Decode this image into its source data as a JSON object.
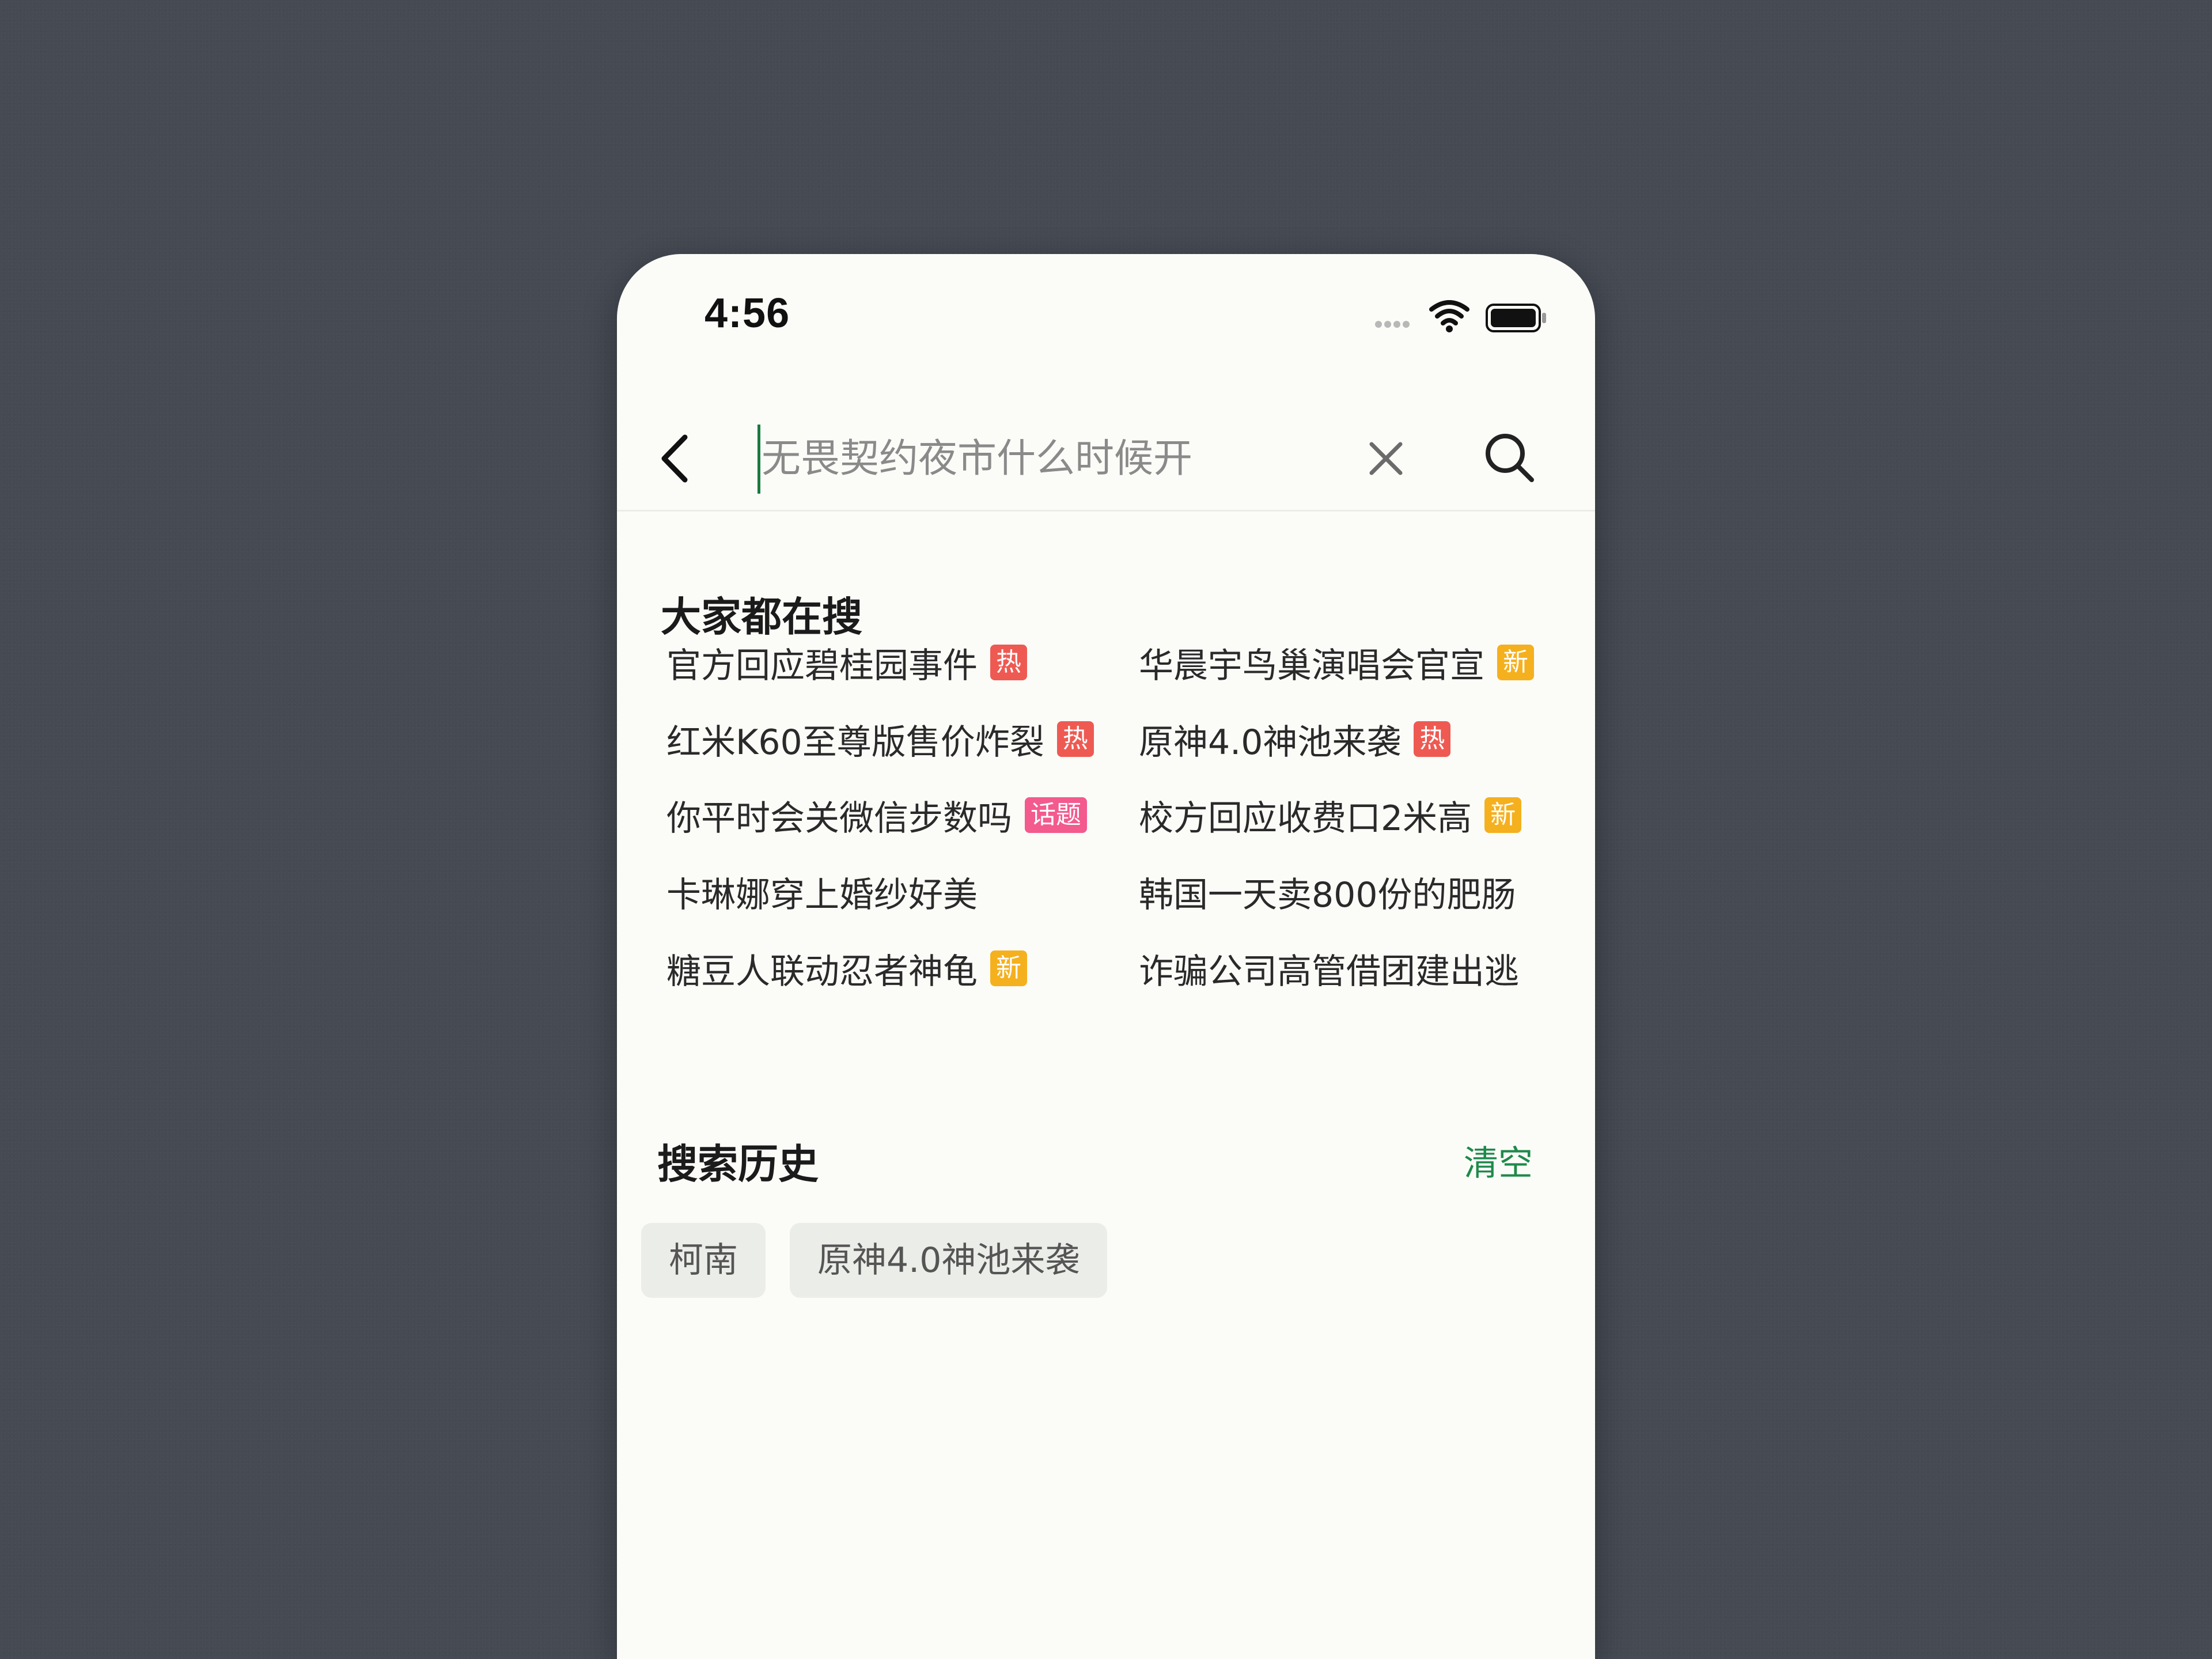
{
  "status": {
    "time": "4:56"
  },
  "search": {
    "placeholder": "无畏契约夜市什么时候开"
  },
  "hot": {
    "title": "大家都在搜",
    "items": [
      {
        "text": "官方回应碧桂园事件",
        "tag": "热"
      },
      {
        "text": "华晨宇鸟巢演唱会官宣",
        "tag": "新"
      },
      {
        "text": "红米K60至尊版售价炸裂",
        "tag": "热"
      },
      {
        "text": "原神4.0神池来袭",
        "tag": "热"
      },
      {
        "text": "你平时会关微信步数吗",
        "tag": "话题"
      },
      {
        "text": "校方回应收费口2米高",
        "tag": "新"
      },
      {
        "text": "卡琳娜穿上婚纱好美",
        "tag": ""
      },
      {
        "text": "韩国一天卖800份的肥肠",
        "tag": ""
      },
      {
        "text": "糖豆人联动忍者神龟",
        "tag": "新"
      },
      {
        "text": "诈骗公司高管借团建出逃",
        "tag": ""
      }
    ]
  },
  "history": {
    "title": "搜索历史",
    "clear_label": "清空",
    "items": [
      "柯南",
      "原神4.0神池来袭"
    ]
  },
  "colors": {
    "accent": "#1e8a4a",
    "tag_hot": "#ee5a52",
    "tag_new": "#f5b01e",
    "tag_topic": "#f35a8e"
  },
  "icons": [
    "back-arrow-icon",
    "clear-x-icon",
    "search-icon",
    "signal-dots-icon",
    "wifi-icon",
    "battery-icon"
  ]
}
